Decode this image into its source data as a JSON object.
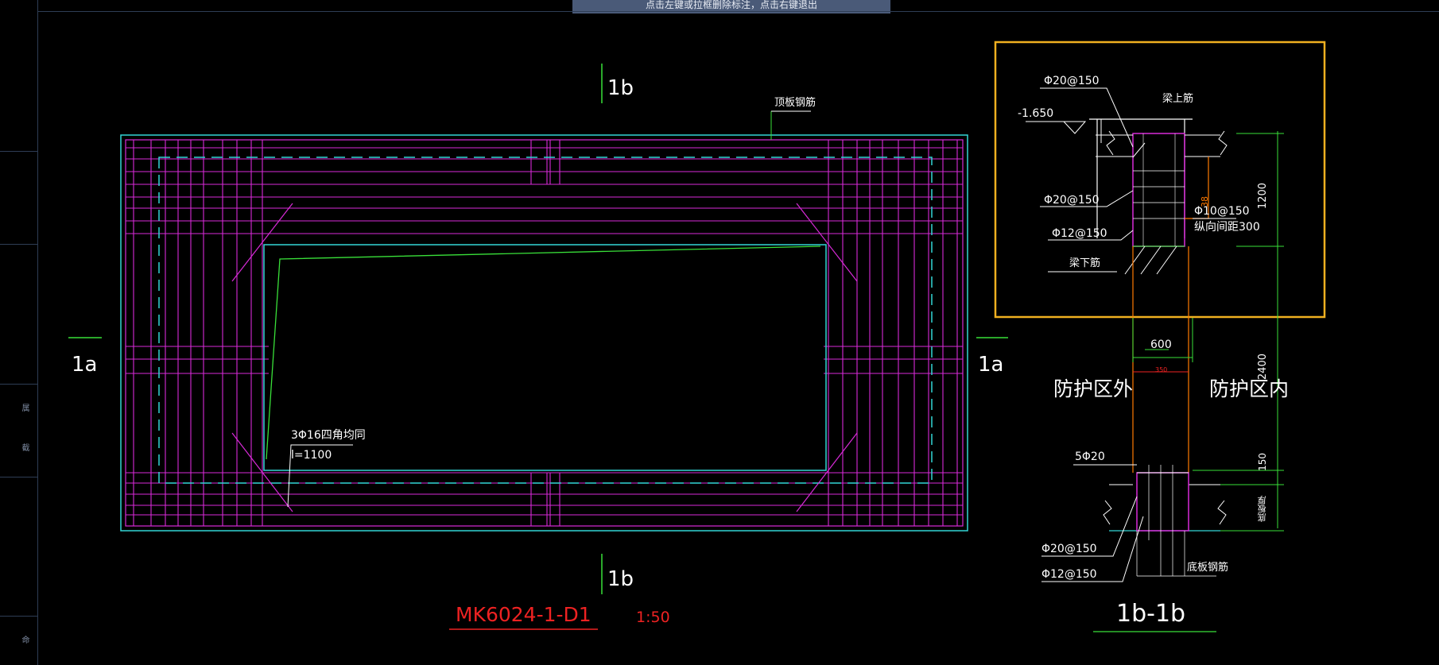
{
  "banner": {
    "hint_text": "点击左键或拉框删除标注，点击右键退出"
  },
  "left_panel": {
    "label_1": "属",
    "label_2": "截",
    "label_3": "命"
  },
  "plan": {
    "section_top": "1b",
    "section_bottom": "1b",
    "section_left": "1a",
    "section_right": "1a",
    "top_bar_label": "顶板钢筋",
    "corner_bar_line1": "3Φ16四角均同",
    "corner_bar_line2": "l=1100",
    "drawing_title": "MK6024-1-D1",
    "scale": "1:50"
  },
  "section": {
    "rebar_top_1": "Φ20@150",
    "elevation": "-1.650",
    "beam_top": "梁上筋",
    "rebar_mid_1": "Φ20@150",
    "rebar_stirrup": "Φ10@150",
    "rebar_spacing": "纵向间距300",
    "rebar_mid_2": "Φ12@150",
    "beam_bottom": "梁下筋",
    "dim_1200": "1200",
    "dim_38": "38",
    "dim_600": "600",
    "dim_350": "350",
    "dim_2400": "2400",
    "zone_outside": "防护区外",
    "zone_inside": "防护区内",
    "rebar_5": "5Φ20",
    "dim_150": "150",
    "base_thickness": "底板厚",
    "rebar_bottom_1": "Φ20@150",
    "rebar_bottom_2": "Φ12@150",
    "base_bar": "底板钢筋",
    "section_title": "1b-1b"
  },
  "colors": {
    "cyan": "#33d6d6",
    "magenta": "#d82ad8",
    "green": "#39e039",
    "red": "#ee2222",
    "orange": "#ff7a00",
    "yellow": "#f0b020",
    "white": "#ffffff"
  }
}
